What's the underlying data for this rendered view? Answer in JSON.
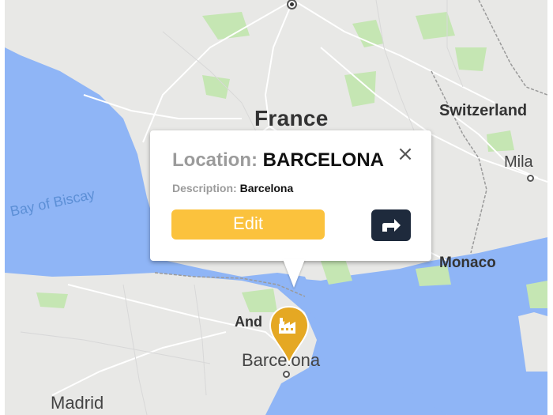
{
  "map": {
    "labels": {
      "country": "France",
      "switzerland": "Switzerland",
      "milan": "Mila",
      "bay": "Bay of Biscay",
      "monaco": "Monaco",
      "andorra": "And",
      "barcelona": "Barcelona",
      "madrid": "Madrid"
    },
    "colors": {
      "land": "#e8e8e6",
      "sea": "#8fb5f6",
      "park": "#c5e6b3",
      "road": "#ffffff",
      "border": "#9a9a9a"
    }
  },
  "popup": {
    "location_label": "Location:",
    "location_value": "BARCELONA",
    "description_label": "Description:",
    "description_value": "Barcelona",
    "close_icon": "×",
    "edit_label": "Edit",
    "navigate_icon": "directions-arrow-icon"
  },
  "marker": {
    "icon": "factory-icon",
    "color": "#e5a823"
  }
}
